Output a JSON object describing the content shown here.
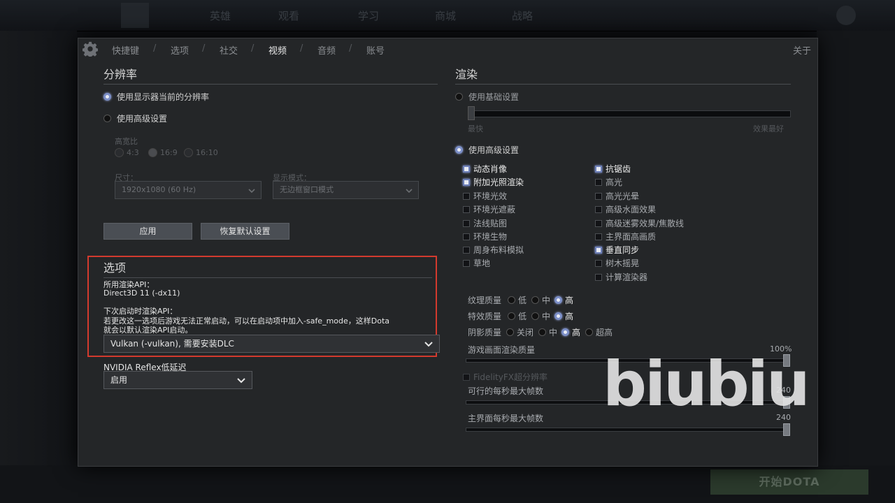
{
  "background": {
    "nav_items": [
      "英雄",
      "观看",
      "学习",
      "商城",
      "战略"
    ],
    "play_button": "开始DOTA"
  },
  "tabs": {
    "items": [
      {
        "label": "快捷键"
      },
      {
        "label": "选项"
      },
      {
        "label": "社交"
      },
      {
        "label": "视频"
      },
      {
        "label": "音频"
      },
      {
        "label": "账号"
      }
    ],
    "active": "视频",
    "about": "关于"
  },
  "resolution": {
    "title": "分辨率",
    "use_monitor": "使用显示器当前的分辨率",
    "use_advanced": "使用高级设置",
    "aspect_label": "高宽比",
    "aspect_options": [
      "4:3",
      "16:9",
      "16:10"
    ],
    "size_label": "尺寸：",
    "size_value": "1920x1080 (60 Hz)",
    "display_mode_label": "显示模式：",
    "display_mode_value": "无边框窗口模式",
    "apply": "应用",
    "restore_default": "恢复默认设置"
  },
  "options": {
    "title": "选项",
    "api_label": "所用渲染API：",
    "api_value": "Direct3D 11 (-dx11)",
    "next_api_label": "下次启动时渲染API：",
    "note_line1": "若更改这一选项后游戏无法正常启动，可以在启动项中加入-safe_mode，这样Dota",
    "note_line2": "就会以默认渲染API启动。",
    "api_select": "Vulkan (-vulkan), 需要安装DLC",
    "reflex_label": "NVIDIA Reflex低延迟",
    "reflex_value": "启用"
  },
  "rendering": {
    "title": "渲染",
    "use_basic": "使用基础设置",
    "slider_left": "最快",
    "slider_right": "效果最好",
    "use_advanced": "使用高级设置",
    "left_checks": [
      {
        "label": "动态肖像",
        "checked": true
      },
      {
        "label": "附加光照渲染",
        "checked": true
      },
      {
        "label": "环境光效",
        "checked": false
      },
      {
        "label": "环境光遮蔽",
        "checked": false
      },
      {
        "label": "法线贴图",
        "checked": false
      },
      {
        "label": "环境生物",
        "checked": false
      },
      {
        "label": "周身布料模拟",
        "checked": false
      },
      {
        "label": "草地",
        "checked": false
      }
    ],
    "right_checks": [
      {
        "label": "抗锯齿",
        "checked": true
      },
      {
        "label": "高光",
        "checked": false
      },
      {
        "label": "高光光晕",
        "checked": false
      },
      {
        "label": "高级水面效果",
        "checked": false
      },
      {
        "label": "高级迷雾效果/焦散线",
        "checked": false
      },
      {
        "label": "主界面高画质",
        "checked": false
      },
      {
        "label": "垂直同步",
        "checked": true
      },
      {
        "label": "树木摇晃",
        "checked": false
      },
      {
        "label": "计算渲染器",
        "checked": false
      }
    ],
    "texture_label": "纹理质量",
    "effects_label": "特效质量",
    "shadow_label": "阴影质量",
    "q_low": "低",
    "q_mid": "中",
    "q_high": "高",
    "q_off": "关闭",
    "q_ultra": "超高",
    "render_quality_label": "游戏画面渲染质量",
    "render_quality_value": "100%",
    "fsr_label": "FidelityFX超分辨率",
    "max_fps_label": "可行的每秒最大帧数",
    "max_fps_value": "240",
    "menu_fps_label": "主界面每秒最大帧数",
    "menu_fps_value": "240"
  },
  "watermark": "biubiu"
}
